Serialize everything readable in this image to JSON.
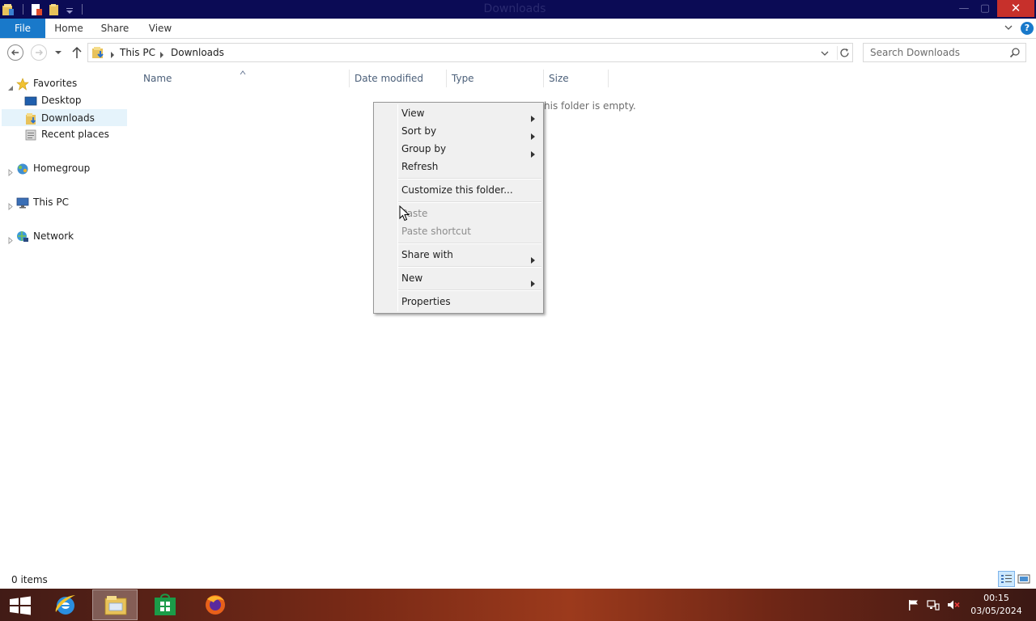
{
  "window": {
    "title": "Downloads",
    "close_glyph": "✕",
    "minimize_glyph": "—",
    "maximize_glyph": "▢"
  },
  "ribbon": {
    "tabs": [
      {
        "label": "File"
      },
      {
        "label": "Home"
      },
      {
        "label": "Share"
      },
      {
        "label": "View"
      }
    ],
    "help_glyph": "?"
  },
  "address": {
    "crumbs": [
      "This PC",
      "Downloads"
    ],
    "search_placeholder": "Search Downloads"
  },
  "nav_pane": {
    "favorites": "Favorites",
    "desktop": "Desktop",
    "downloads": "Downloads",
    "recent_places": "Recent places",
    "homegroup": "Homegroup",
    "this_pc": "This PC",
    "network": "Network"
  },
  "columns": [
    "Name",
    "Date modified",
    "Type",
    "Size"
  ],
  "empty_message": "his folder is empty.",
  "context_menu": {
    "items": [
      {
        "label": "View",
        "submenu": true,
        "enabled": true
      },
      {
        "label": "Sort by",
        "submenu": true,
        "enabled": true
      },
      {
        "label": "Group by",
        "submenu": true,
        "enabled": true
      },
      {
        "label": "Refresh",
        "submenu": false,
        "enabled": true
      },
      {
        "label": "Customize this folder...",
        "submenu": false,
        "enabled": true
      },
      {
        "label": "Paste",
        "submenu": false,
        "enabled": false
      },
      {
        "label": "Paste shortcut",
        "submenu": false,
        "enabled": false
      },
      {
        "label": "Share with",
        "submenu": true,
        "enabled": true
      },
      {
        "label": "New",
        "submenu": true,
        "enabled": true
      },
      {
        "label": "Properties",
        "submenu": false,
        "enabled": true
      }
    ]
  },
  "status_bar": {
    "item_count": "0 items"
  },
  "taskbar": {
    "apps": [
      "internet-explorer",
      "file-explorer",
      "store",
      "firefox"
    ],
    "active_app": "file-explorer",
    "time": "00:15",
    "date": "03/05/2024"
  },
  "colors": {
    "title_bar": "#0b0b55",
    "file_tab": "#1979ca",
    "close_button": "#c7302b",
    "selection": "#e5f3fb"
  }
}
